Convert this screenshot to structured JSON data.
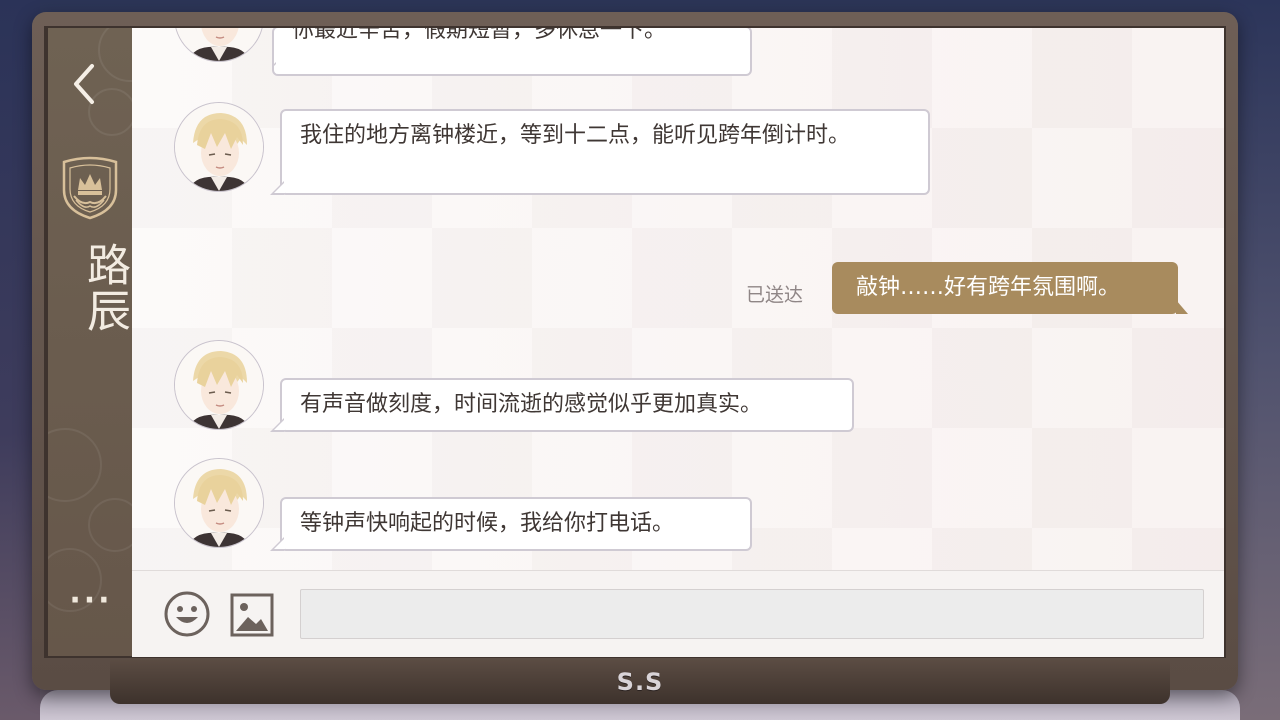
{
  "contact": {
    "name": "路辰"
  },
  "messages": [
    {
      "id": "m0",
      "direction": "incoming",
      "text": "你最近辛苦，假期短暂，多休息一下。"
    },
    {
      "id": "m1",
      "direction": "incoming",
      "text": "我住的地方离钟楼近，等到十二点，能听见跨年倒计时。"
    },
    {
      "id": "m2",
      "direction": "outgoing",
      "text": "敲钟……好有跨年氛围啊。",
      "status": "已送达"
    },
    {
      "id": "m3",
      "direction": "incoming",
      "text": "有声音做刻度，时间流逝的感觉似乎更加真实。"
    },
    {
      "id": "m4",
      "direction": "incoming",
      "text": "等钟声快响起的时候，我给你打电话。"
    }
  ],
  "sidebar": {
    "more_label": "···"
  },
  "device": {
    "brand": "S.S"
  },
  "input": {
    "value": "",
    "placeholder": ""
  },
  "icons": {
    "back": "chevron-left-icon",
    "crest": "crown-crest-icon",
    "emoji": "smiley-icon",
    "image": "image-icon"
  },
  "colors": {
    "outgoing_bubble": "#a88b5e",
    "incoming_bubble": "#ffffff",
    "sidebar": "#6f6253",
    "frame": "#5a4c44"
  }
}
